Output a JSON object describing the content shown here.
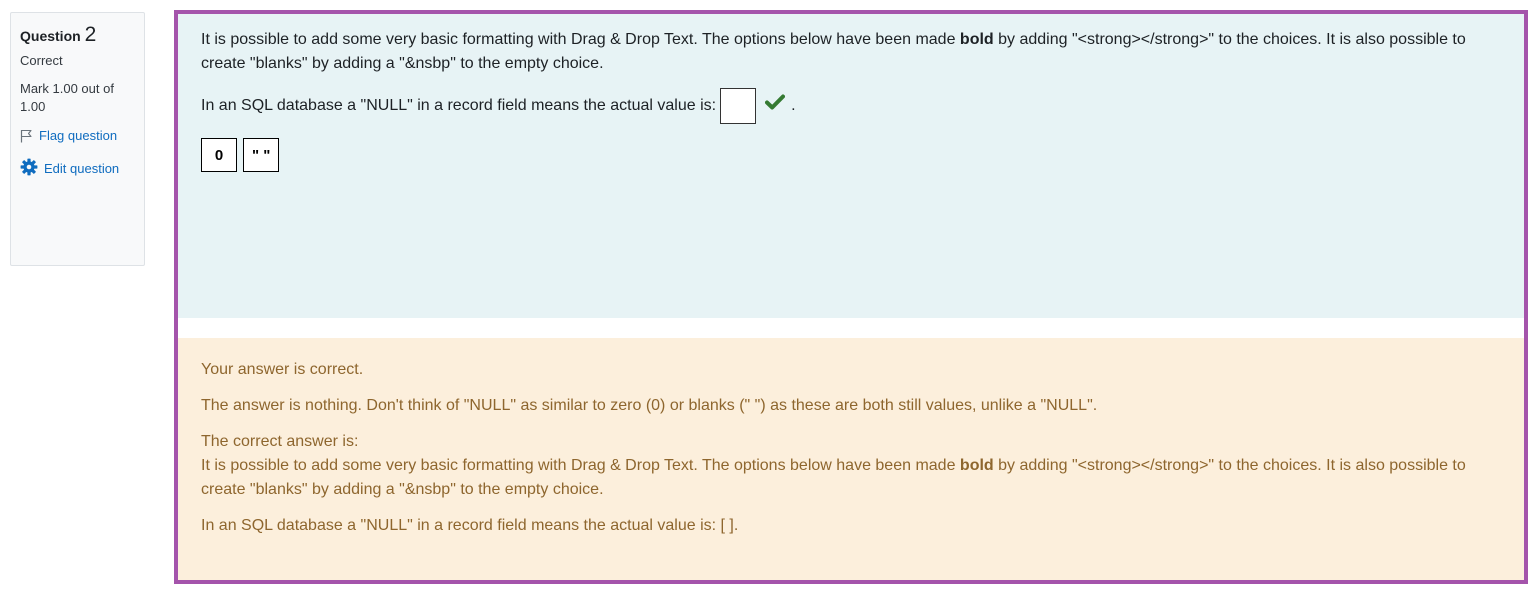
{
  "info": {
    "question_label": "Question",
    "question_number": "2",
    "state": "Correct",
    "grade": "Mark 1.00 out of 1.00",
    "flag_label": "Flag question",
    "edit_label": "Edit question",
    "link_color": "#0f6cbf"
  },
  "question": {
    "intro_part1": "It is possible to add some very basic formatting with Drag & Drop Text. The options below have been made ",
    "intro_bold": "bold",
    "intro_part2": " by adding \"<strong></strong>\" to the choices. It is also possible to create \"blanks\" by adding a \"&nsbp\" to the empty choice.",
    "prompt": "In an SQL database a \"NULL\" in a record field means the actual value is:",
    "prompt_end": ".",
    "choices": [
      "0",
      "\" \""
    ]
  },
  "feedback": {
    "correct_msg": "Your answer is correct.",
    "explanation": "The answer is nothing. Don't think of \"NULL\" as similar to zero (0) or blanks (\" \") as these are both still values, unlike a \"NULL\".",
    "right_answer_label": "The correct answer is:",
    "ra_part1": "It is possible to add some very basic formatting with Drag & Drop Text. The options below have been made ",
    "ra_bold": "bold",
    "ra_part2": " by adding \"<strong></strong>\" to the choices. It is also possible to create \"blanks\" by adding a \"&nsbp\" to the empty choice.",
    "ra_sentence": "In an SQL database a \"NULL\" in a record field means the actual value is: [ ]."
  },
  "colors": {
    "border": "#a454ab",
    "formulation_bg": "#e7f3f5",
    "outcome_bg": "#fcefdc",
    "outcome_text": "#8e662e",
    "check": "#357a32"
  }
}
